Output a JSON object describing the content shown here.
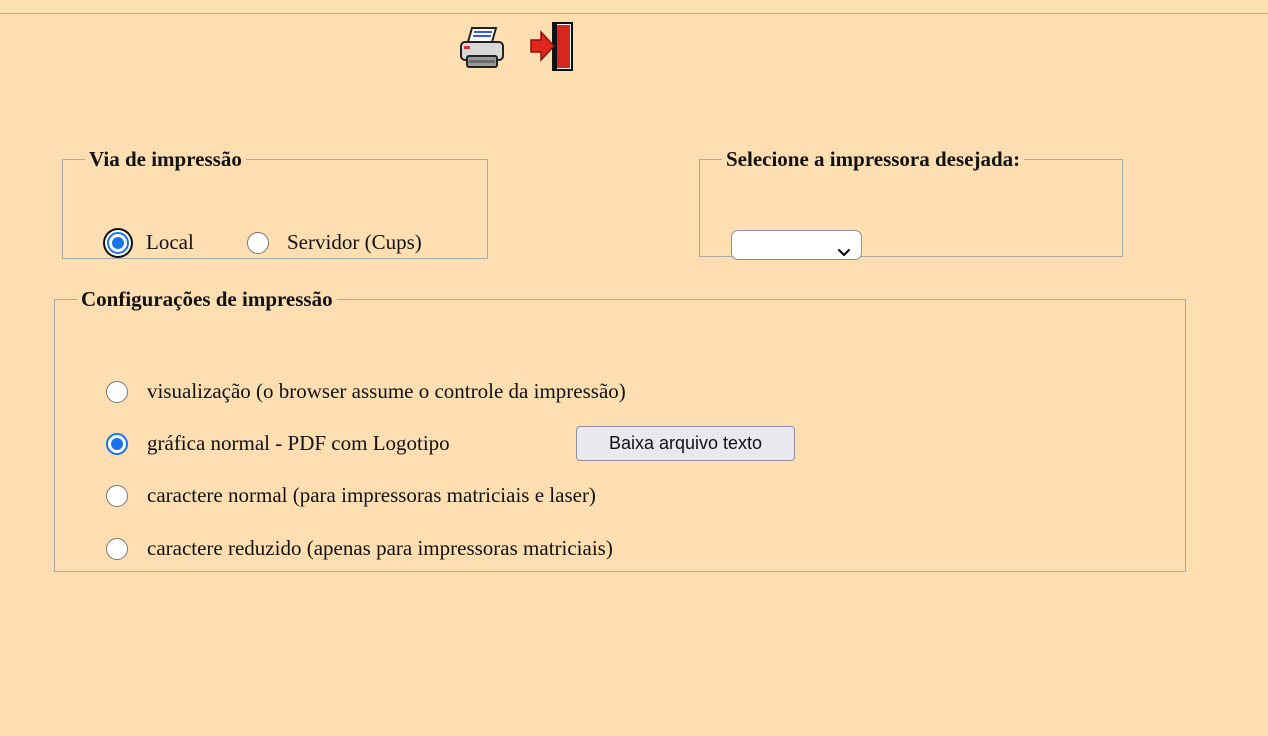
{
  "toolbar": {
    "print_icon": "printer-icon",
    "exit_icon": "exit-door-icon"
  },
  "via": {
    "legend": "Via de impressão",
    "options": [
      {
        "label": "Local",
        "checked": true
      },
      {
        "label": "Servidor (Cups)",
        "checked": false
      }
    ]
  },
  "printer": {
    "legend": "Selecione a impressora desejada:",
    "selected": ""
  },
  "config": {
    "legend": "Configurações de impressão",
    "options": [
      {
        "label": "visualização (o browser assume o controle da impressão)",
        "checked": false
      },
      {
        "label": "gráfica normal - PDF com Logotipo",
        "checked": true
      },
      {
        "label": "caractere normal (para impressoras matriciais e laser)",
        "checked": false
      },
      {
        "label": "caractere reduzido (apenas para impressoras matriciais)",
        "checked": false
      }
    ],
    "download_button": "Baixa arquivo texto"
  },
  "colors": {
    "background": "#ffdfb2",
    "accent": "#1a73e8",
    "exit_red": "#e3261c"
  }
}
